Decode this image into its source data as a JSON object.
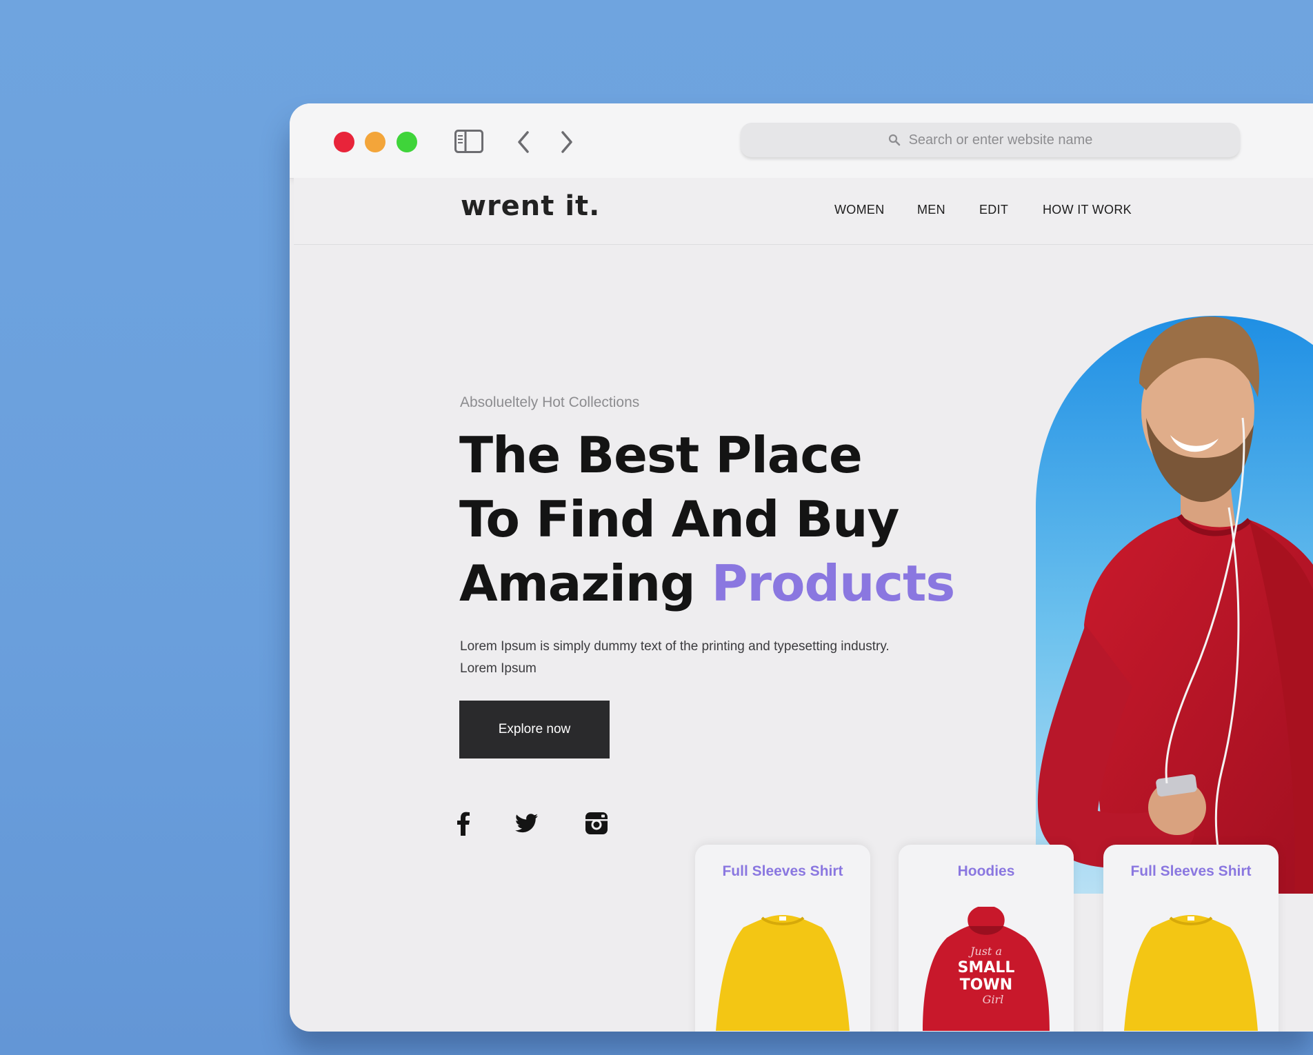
{
  "browser": {
    "address_placeholder": "Search or enter website name"
  },
  "site": {
    "logo": "wrent it.",
    "menu": [
      "WOMEN",
      "MEN",
      "EDIT",
      "HOW IT WORK"
    ]
  },
  "hero": {
    "kicker": "Absolueltely Hot Collections",
    "title_line1": "The Best Place",
    "title_line2": "To Find And Buy",
    "title_line3a": "Amazing ",
    "title_line3b": "Products",
    "description": "Lorem Ipsum is simply dummy text of the printing and typesetting industry. Lorem Ipsum",
    "cta_label": "Explore now",
    "accent_color": "#8a77e0"
  },
  "social": [
    "facebook-icon",
    "twitter-icon",
    "instagram-icon"
  ],
  "cards": [
    {
      "title": "Full Sleeves Shirt",
      "garment_color": "#f3c614"
    },
    {
      "title": "Hoodies",
      "garment_color": "#c8182b",
      "print": [
        "Just a",
        "SMALL",
        "TOWN",
        "Girl"
      ]
    },
    {
      "title": "Full Sleeves Shirt",
      "garment_color": "#f3c614"
    }
  ]
}
